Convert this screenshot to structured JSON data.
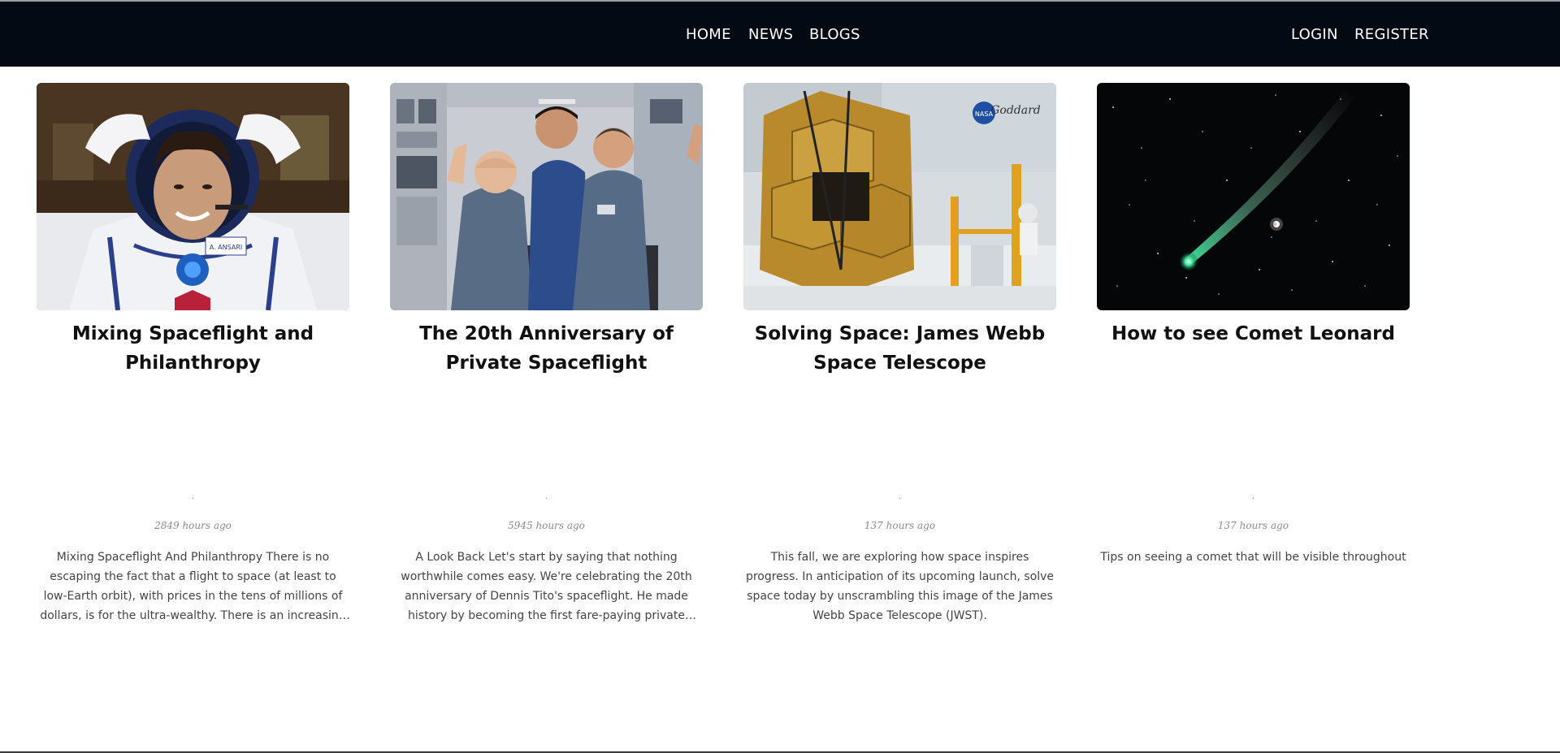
{
  "nav": {
    "home": "HOME",
    "news": "NEWS",
    "blogs": "BLOGS",
    "login": "LOGIN",
    "register": "REGISTER"
  },
  "colors": {
    "navbar_bg": "#030a14",
    "nav_text": "#ffffff",
    "title_text": "#111111",
    "excerpt_text": "#444444",
    "time_text": "#8a8a8a"
  },
  "posts": [
    {
      "title": "Mixing Spaceflight and Philanthropy",
      "dot": ".",
      "time": "2849 hours ago",
      "excerpt": "Mixing Spaceflight And Philanthropy There is no escaping the fact that a flight to space (at least to low-Earth orbit), with prices in the tens of millions of dollars, is for the ultra-wealthy. There is an increasing trend of wealthy individuals",
      "image": "astronaut-portrait",
      "image_text": "A. ANSARI"
    },
    {
      "title": "The 20th Anniversary of Private Spaceflight",
      "dot": ".",
      "time": "5945 hours ago",
      "excerpt": "A Look Back Let's start by saying that nothing worthwhile comes easy. We're celebrating the 20th anniversary of Dennis Tito's spaceflight. He made history by becoming the first fare-paying private citizen to launch to space. Before",
      "image": "crew-in-space-station"
    },
    {
      "title": "Solving Space: James Webb Space Telescope",
      "dot": ".",
      "time": "137 hours ago",
      "excerpt": "This fall, we are exploring how space inspires progress. In anticipation of its upcoming launch, solve space today by unscrambling this image of the James Webb Space Telescope (JWST).",
      "image": "telescope-clean-room",
      "image_text": "NASA Goddard"
    },
    {
      "title": "How to see Comet Leonard",
      "dot": ".",
      "time": "137 hours ago",
      "excerpt": "Tips on seeing a comet that will be visible throughout",
      "image": "comet-night-sky"
    }
  ]
}
